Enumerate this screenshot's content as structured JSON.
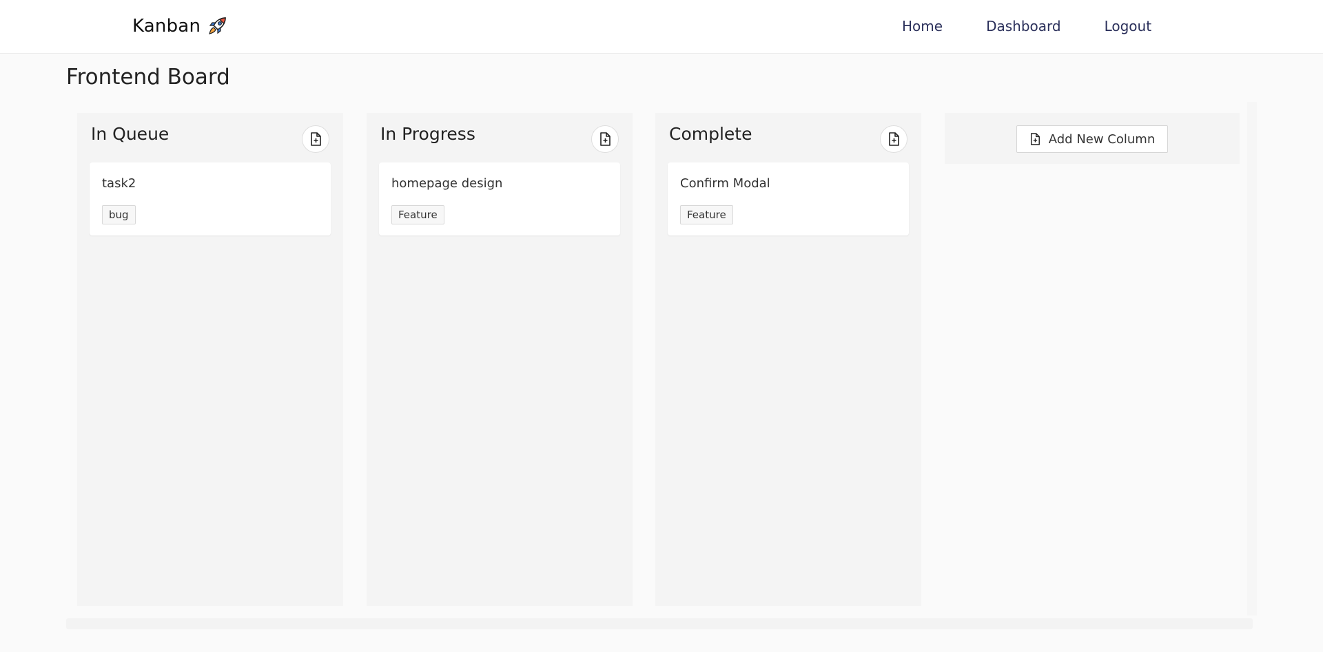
{
  "nav": {
    "brand": "Kanban",
    "brand_icon": "rocket-icon",
    "links": [
      "Home",
      "Dashboard",
      "Logout"
    ]
  },
  "board": {
    "title": "Frontend Board",
    "columns": [
      {
        "title": "In Queue",
        "cards": [
          {
            "title": "task2",
            "tag": "bug"
          }
        ]
      },
      {
        "title": "In Progress",
        "cards": [
          {
            "title": "homepage design",
            "tag": "Feature"
          }
        ]
      },
      {
        "title": "Complete",
        "cards": [
          {
            "title": "Confirm Modal",
            "tag": "Feature"
          }
        ]
      }
    ],
    "add_column_label": "Add New Column",
    "add_card_icon": "file-plus-icon"
  },
  "colors": {
    "nav_link": "#2a2f5a",
    "background": "#fafafa",
    "column": "#f4f4f4",
    "rocket_body": "#3a7bd5",
    "rocket_fire": "#e8543f"
  }
}
